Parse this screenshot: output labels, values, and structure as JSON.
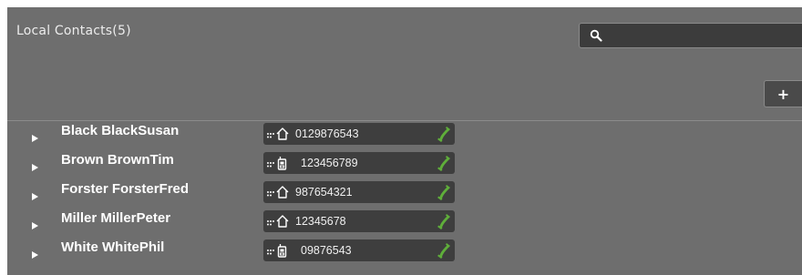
{
  "header": {
    "title": "Local Contacts(5)"
  },
  "search": {
    "placeholder": "",
    "value": "",
    "icon": "search-icon"
  },
  "toolbar": {
    "add_label": "+"
  },
  "colors": {
    "panel": "#6e6e6e",
    "field": "#3e3e3e",
    "call": "#5fae3a"
  },
  "contacts": [
    {
      "name": "Black BlackSusan",
      "number": "0129876543",
      "type": "home"
    },
    {
      "name": "Brown BrownTim",
      "number": "123456789",
      "type": "mobile"
    },
    {
      "name": "Forster ForsterFred",
      "number": "987654321",
      "type": "home"
    },
    {
      "name": "Miller MillerPeter",
      "number": "12345678",
      "type": "home"
    },
    {
      "name": "White WhitePhil",
      "number": "09876543",
      "type": "mobile"
    }
  ]
}
